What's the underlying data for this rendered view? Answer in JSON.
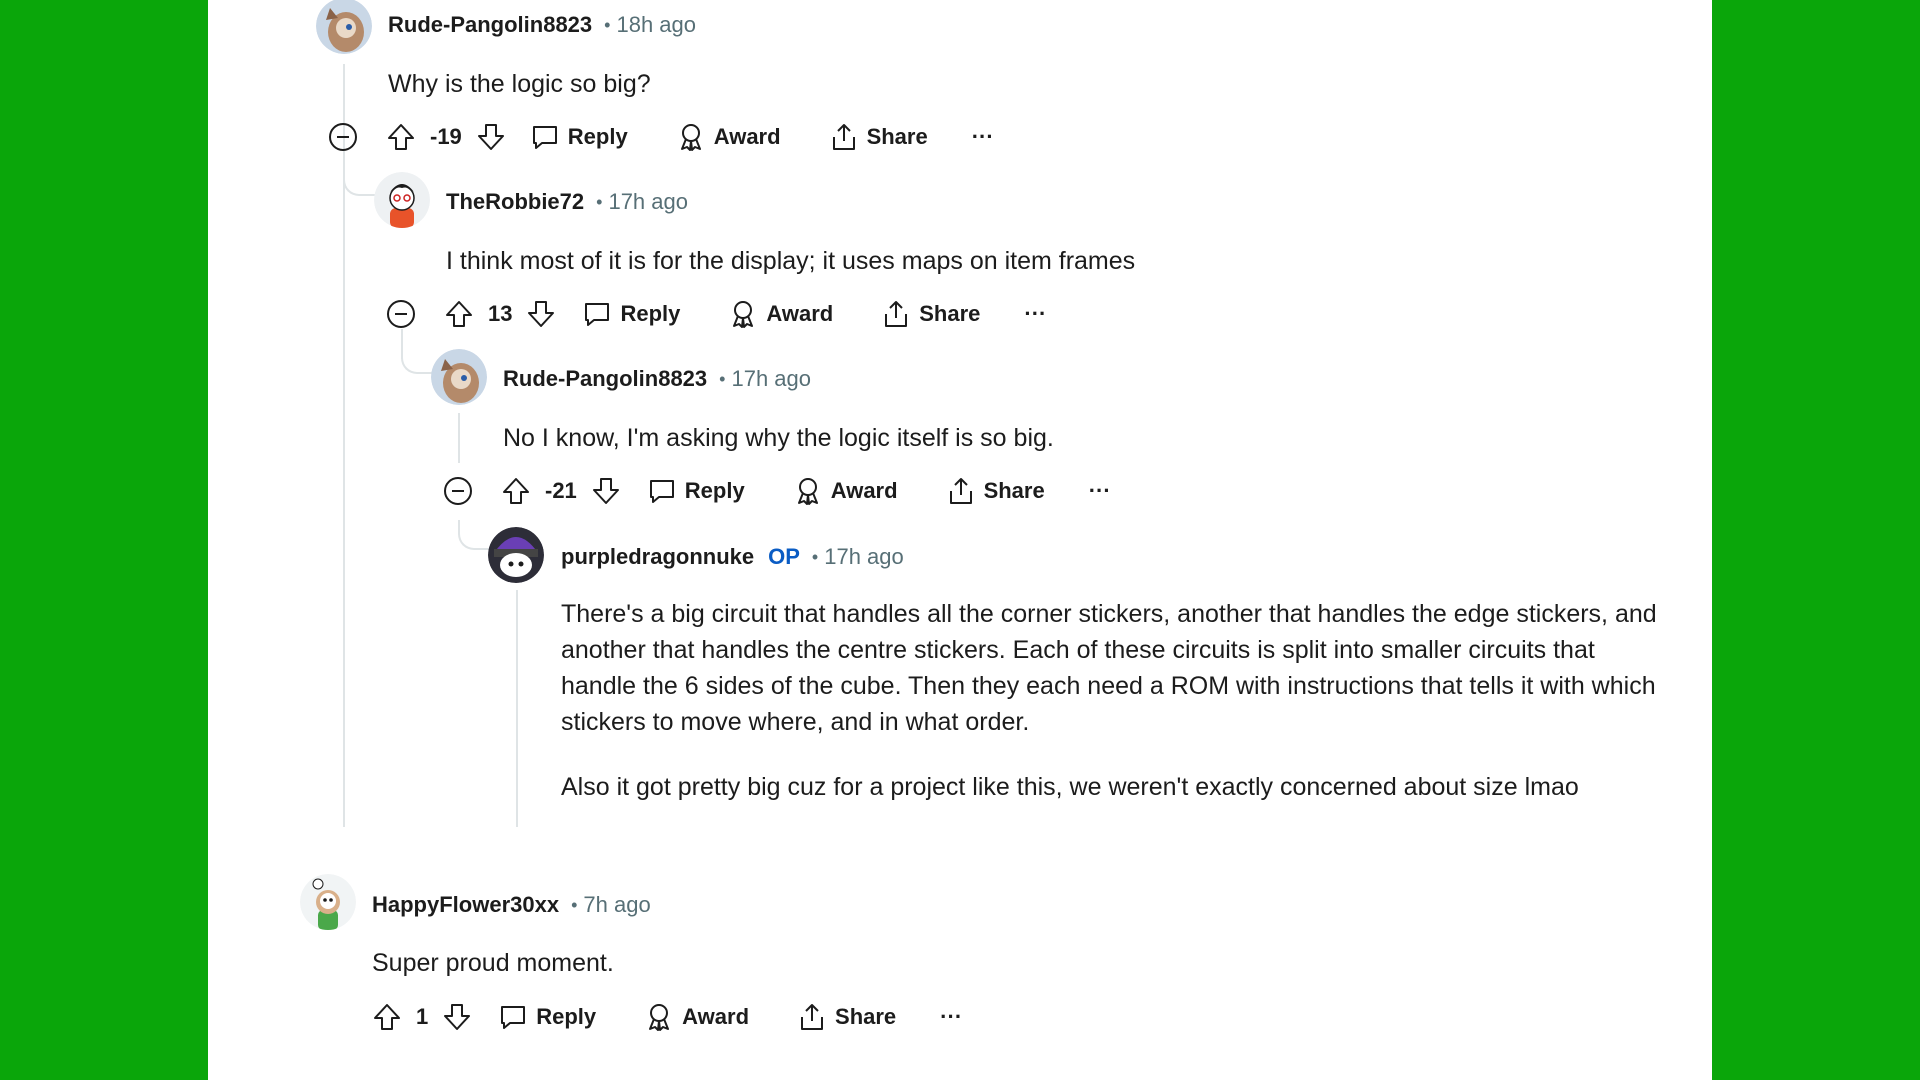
{
  "colors": {
    "background": "#0aa60a",
    "panel": "#ffffff",
    "op": "#0a5cc4",
    "meta": "#576f76",
    "thread_line": "#dfe4e6"
  },
  "icons": {
    "upvote": "arrow-up-outline",
    "downvote": "arrow-down-outline",
    "reply": "speech-bubble",
    "award": "award-ribbon",
    "share": "share-upload",
    "more": "ellipsis",
    "collapse": "minus-circle"
  },
  "comments": [
    {
      "author": "Rude-Pangolin8823",
      "time": "18h ago",
      "body": [
        "Why is the logic so big?"
      ],
      "score": "-19",
      "reply": "Reply",
      "award": "Award",
      "share": "Share",
      "more": "···"
    },
    {
      "author": "TheRobbie72",
      "time": "17h ago",
      "body": [
        "I think most of it is for the display; it uses maps on item frames"
      ],
      "score": "13",
      "reply": "Reply",
      "award": "Award",
      "share": "Share",
      "more": "···"
    },
    {
      "author": "Rude-Pangolin8823",
      "time": "17h ago",
      "body": [
        "No I know, I'm asking why the logic itself is so big."
      ],
      "score": "-21",
      "reply": "Reply",
      "award": "Award",
      "share": "Share",
      "more": "···"
    },
    {
      "author": "purpledragonnuke",
      "op_badge": "OP",
      "time": "17h ago",
      "body": [
        "There's a big circuit that handles all the corner stickers, another that handles the edge stickers, and another that handles the centre stickers. Each of these circuits is split into smaller circuits that handle the 6 sides of the cube. Then they each need a ROM with instructions that tells it with which stickers to move where, and in what order.",
        "Also it got pretty big cuz for a project like this, we weren't exactly concerned about size lmao"
      ]
    },
    {
      "author": "HappyFlower30xx",
      "time": "7h ago",
      "body": [
        "Super proud moment."
      ],
      "score": "1",
      "reply": "Reply",
      "award": "Award",
      "share": "Share",
      "more": "···"
    }
  ]
}
